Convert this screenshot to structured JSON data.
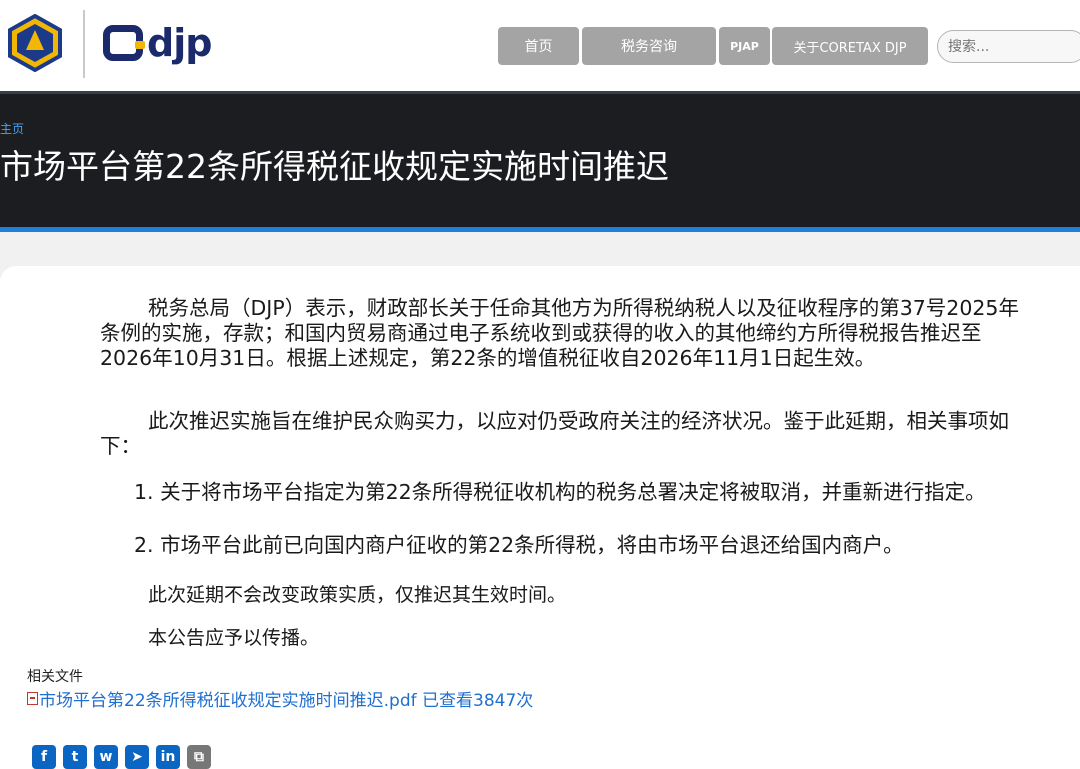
{
  "header": {
    "logo_text": "djp",
    "nav": {
      "home": "首页",
      "consult": "税务咨询",
      "pjap": "PJAP",
      "about": "关于CORETAX DJP"
    },
    "search_placeholder": "搜索..."
  },
  "hero": {
    "breadcrumb": "主页",
    "title": "市场平台第22条所得税征收规定实施时间推迟"
  },
  "article": {
    "p1": "税务总局（DJP）表示，财政部长关于任命其他方为所得税纳税人以及征收程序的第37号2025年条例的实施，存款；和国内贸易商通过电子系统收到或获得的收入的其他缔约方所得税报告推迟至2026年10月31日。根据上述规定，第22条的增值税征收自2026年11月1日起生效。",
    "p2": "此次推迟实施旨在维护民众购买力，以应对仍受政府关注的经济状况。鉴于此延期，相关事项如下：",
    "item1": "1. 关于将市场平台指定为第22条所得税征收机构的税务总署决定将被取消，并重新进行指定。",
    "item2": "2. 市场平台此前已向国内商户征收的第22条所得税，将由市场平台退还给国内商户。",
    "p3": "此次延期不会改变政策实质，仅推迟其生效时间。",
    "p4": "本公告应予以传播。"
  },
  "related": {
    "title": "相关文件",
    "file_link": "市场平台第22条所得税征收规定实施时间推迟.pdf 已查看3847次"
  },
  "share": {
    "facebook": "f",
    "twitter": "t",
    "whatsapp": "w",
    "telegram": "➤",
    "linkedin": "in",
    "copy": "⧉"
  },
  "colors": {
    "hero_bg": "#1b1d20",
    "accent_blue": "#1f80d8",
    "nav_bg": "#a4a4a4",
    "link": "#1f6fd0"
  }
}
